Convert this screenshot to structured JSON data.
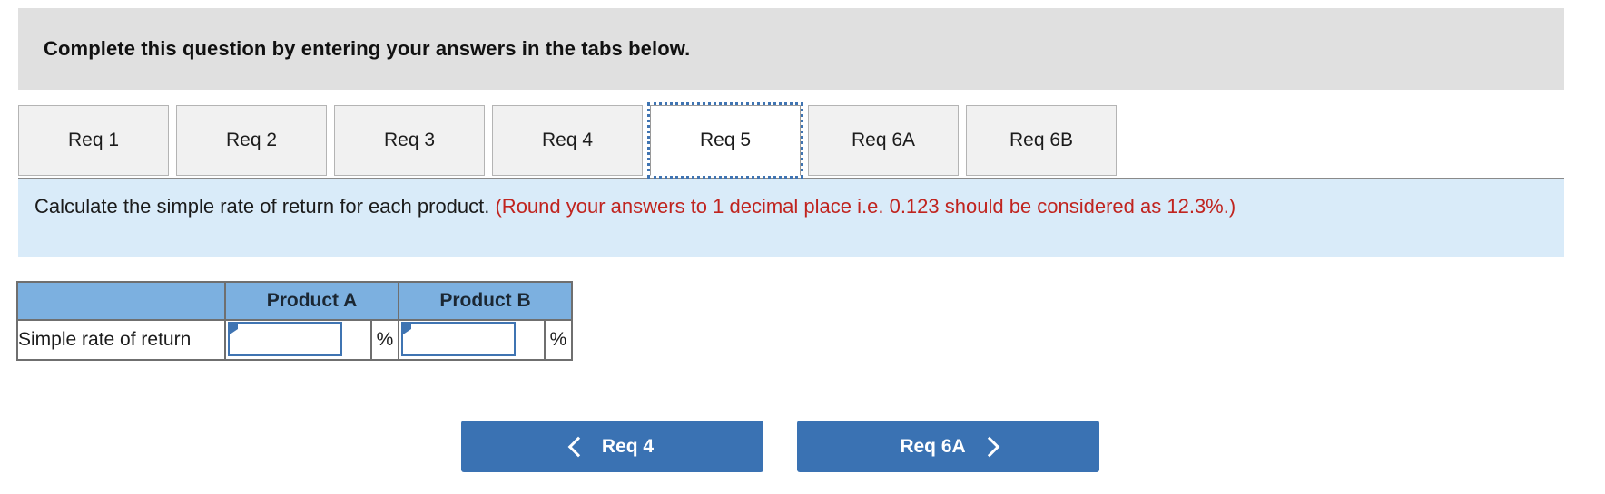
{
  "banner": {
    "title": "Complete this question by entering your answers in the tabs below."
  },
  "tabs": {
    "items": [
      {
        "label": "Req 1",
        "active": false
      },
      {
        "label": "Req 2",
        "active": false
      },
      {
        "label": "Req 3",
        "active": false
      },
      {
        "label": "Req 4",
        "active": false
      },
      {
        "label": "Req 5",
        "active": true
      },
      {
        "label": "Req 6A",
        "active": false
      },
      {
        "label": "Req 6B",
        "active": false
      }
    ]
  },
  "instruction": {
    "plain": "Calculate the simple rate of return for each product. ",
    "hint": "(Round your answers to 1 decimal place i.e. 0.123 should be considered as 12.3%.)"
  },
  "table": {
    "headers": {
      "blank": "",
      "product_a": "Product A",
      "product_b": "Product B"
    },
    "rows": [
      {
        "label": "Simple rate of return",
        "product_a_value": "",
        "product_b_value": "",
        "unit": "%"
      }
    ]
  },
  "navigation": {
    "prev_label": "Req 4",
    "next_label": "Req 6A",
    "prev_icon": "chevron-left-icon",
    "next_icon": "chevron-right-icon"
  },
  "colors": {
    "banner_bg": "#e0e0e0",
    "instruction_bg": "#d9ebf9",
    "hint_text": "#c0241f",
    "table_header_bg": "#7cb0e0",
    "button_bg": "#3a72b3",
    "focus_outline": "#3f74b2"
  }
}
